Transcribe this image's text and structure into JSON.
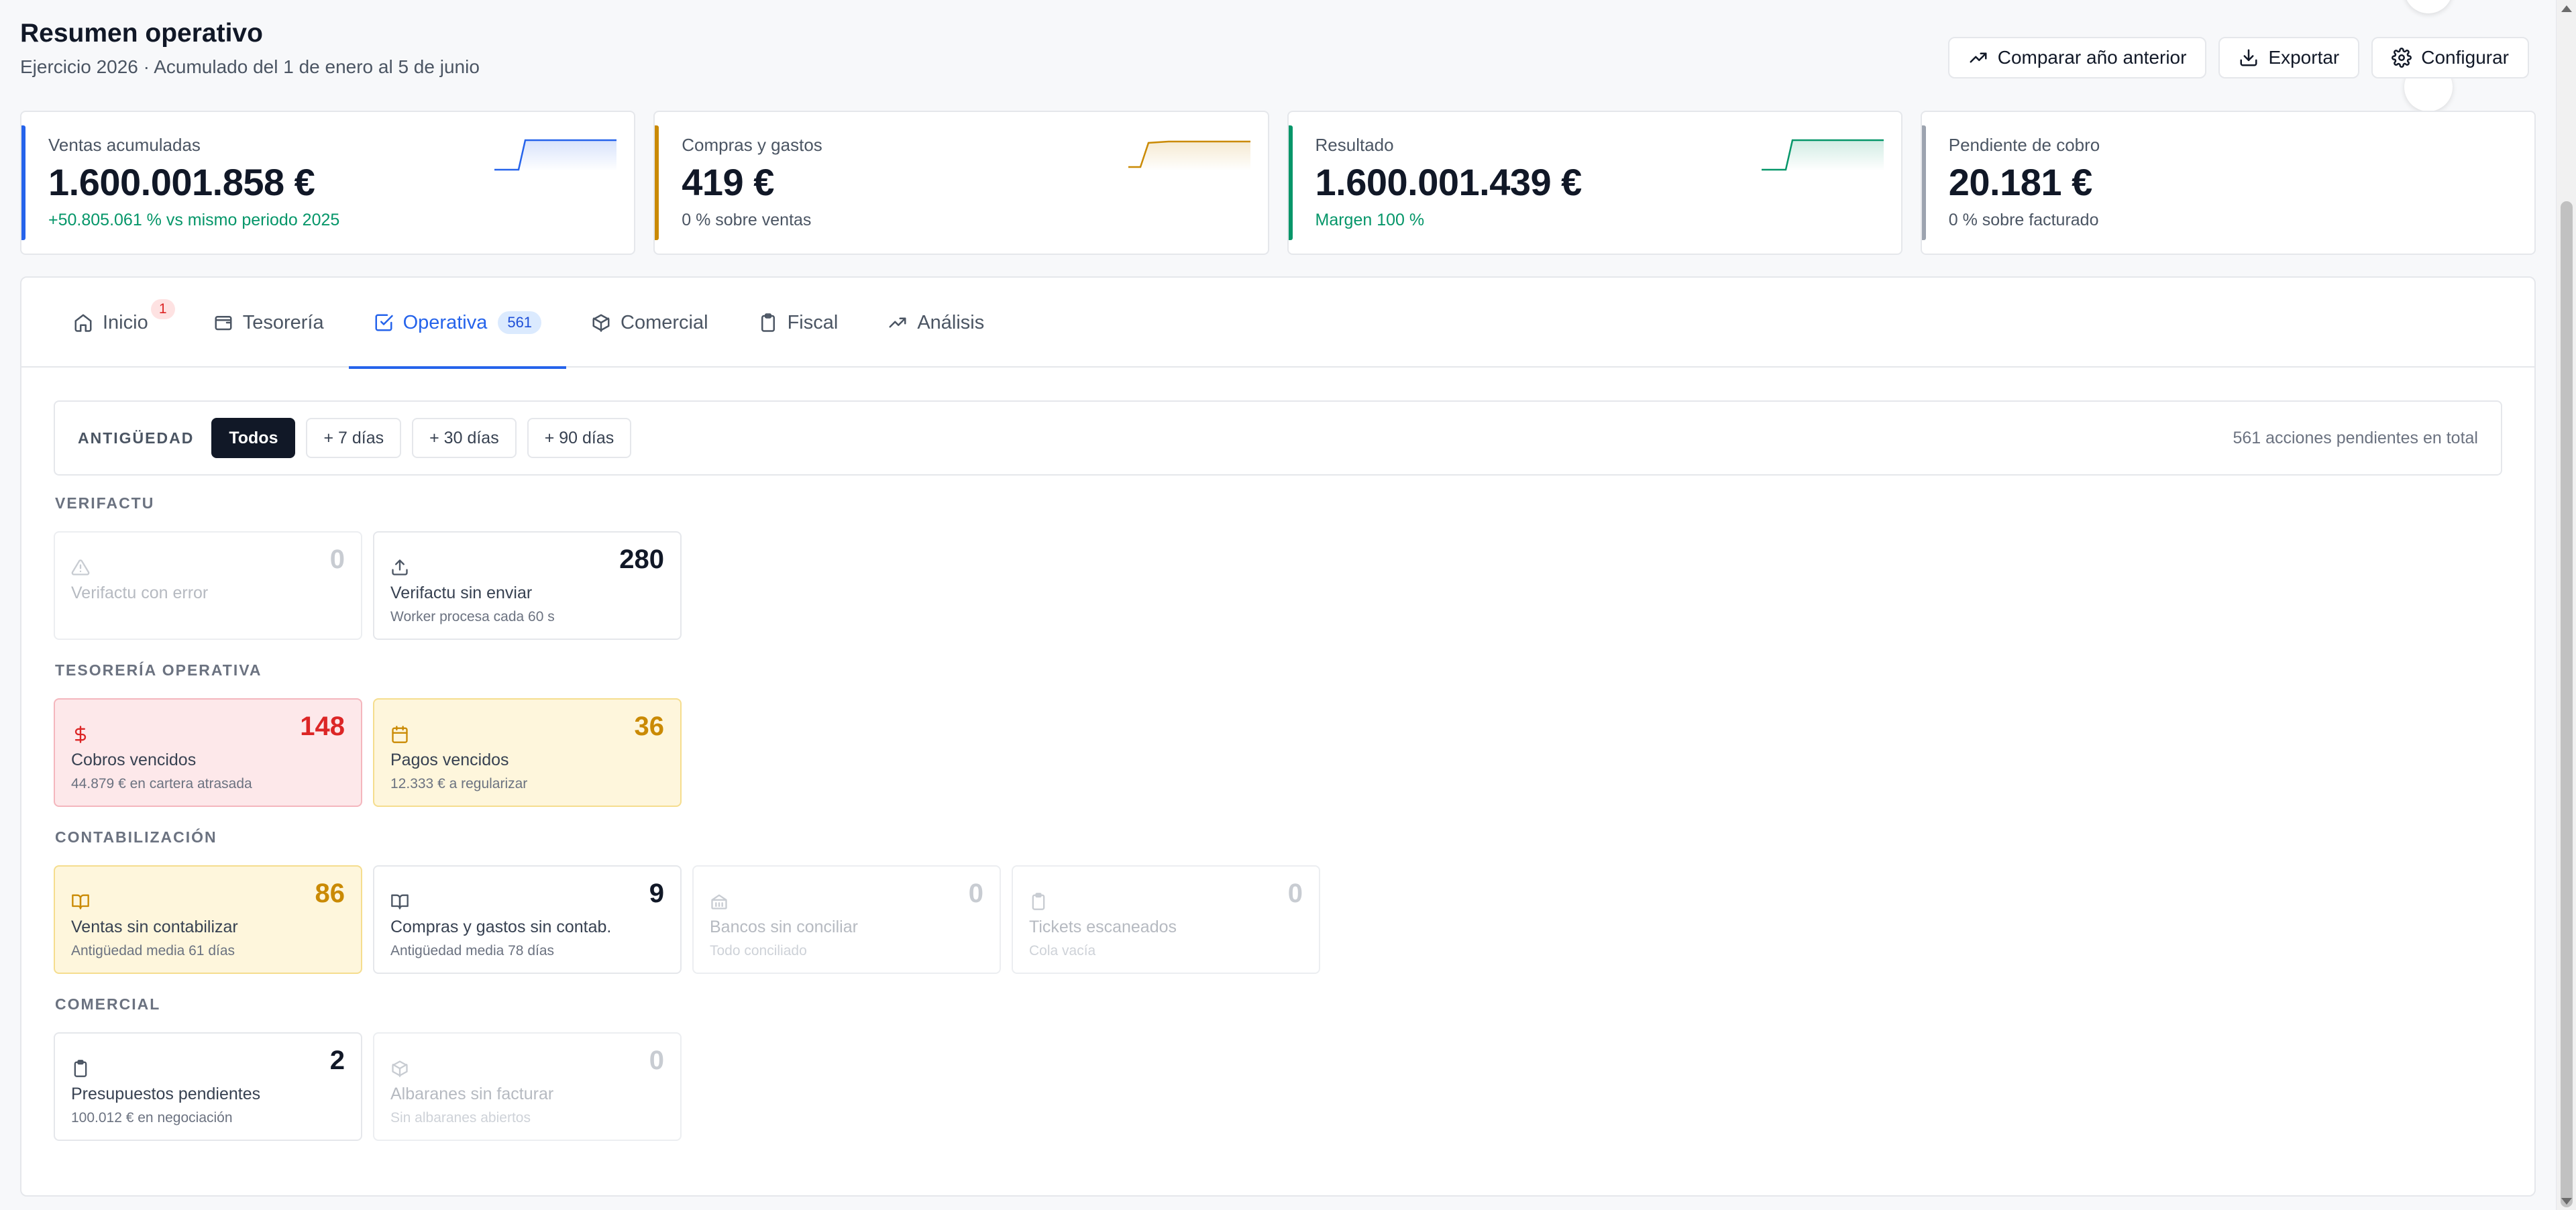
{
  "header": {
    "title": "Resumen operativo",
    "subtitle": "Ejercicio 2026 · Acumulado del 1 de enero al 5 de junio",
    "actions": {
      "compare": "Comparar año anterior",
      "export": "Exportar",
      "configure": "Configurar"
    }
  },
  "kpis": [
    {
      "label": "Ventas acumuladas",
      "value": "1.600.001.858 €",
      "note": "+50.805.061 % vs mismo periodo 2025",
      "color": "#2563eb"
    },
    {
      "label": "Compras y gastos",
      "value": "419 €",
      "note": "0 % sobre ventas",
      "color": "#ca8a04"
    },
    {
      "label": "Resultado",
      "value": "1.600.001.439 €",
      "note": "Margen 100 %",
      "color": "#059669"
    },
    {
      "label": "Pendiente de cobro",
      "value": "20.181 €",
      "note": "0 % sobre facturado",
      "color": "#9ca3af"
    }
  ],
  "tabs": [
    {
      "label": "Inicio",
      "badge": "1",
      "icon": "home-icon"
    },
    {
      "label": "Tesorería",
      "icon": "wallet-icon"
    },
    {
      "label": "Operativa",
      "count": "561",
      "icon": "check-square-icon",
      "active": true
    },
    {
      "label": "Comercial",
      "icon": "box-icon"
    },
    {
      "label": "Fiscal",
      "icon": "clipboard-icon"
    },
    {
      "label": "Análisis",
      "icon": "trend-icon"
    }
  ],
  "filter": {
    "label": "ANTIGÜEDAD",
    "chips": [
      "Todos",
      "+ 7 días",
      "+ 30 días",
      "+ 90 días"
    ],
    "selected": "Todos",
    "total": "561 acciones pendientes en total"
  },
  "sections": {
    "verifactu": {
      "title": "VERIFACTU",
      "cards": [
        {
          "num": "0",
          "title": "Verifactu con error",
          "sub": "",
          "icon": "warning-icon",
          "state": "dim"
        },
        {
          "num": "280",
          "title": "Verifactu sin enviar",
          "sub": "Worker procesa cada 60 s",
          "icon": "upload-icon",
          "state": "normal"
        }
      ]
    },
    "tesoreria": {
      "title": "TESORERÍA OPERATIVA",
      "cards": [
        {
          "num": "148",
          "title": "Cobros vencidos",
          "sub": "44.879 € en cartera atrasada",
          "icon": "dollar-icon",
          "state": "red"
        },
        {
          "num": "36",
          "title": "Pagos vencidos",
          "sub": "12.333 € a regularizar",
          "icon": "calendar-icon",
          "state": "amber"
        }
      ]
    },
    "contabilizacion": {
      "title": "CONTABILIZACIÓN",
      "cards": [
        {
          "num": "86",
          "title": "Ventas sin contabilizar",
          "sub": "Antigüedad media 61 días",
          "icon": "book-icon",
          "state": "amber"
        },
        {
          "num": "9",
          "title": "Compras y gastos sin contab.",
          "sub": "Antigüedad media 78 días",
          "icon": "book-icon",
          "state": "normal"
        },
        {
          "num": "0",
          "title": "Bancos sin conciliar",
          "sub": "Todo conciliado",
          "icon": "bank-icon",
          "state": "dim"
        },
        {
          "num": "0",
          "title": "Tickets escaneados",
          "sub": "Cola vacía",
          "icon": "ticket-icon",
          "state": "dim"
        }
      ]
    },
    "comercial": {
      "title": "COMERCIAL",
      "cards": [
        {
          "num": "2",
          "title": "Presupuestos pendientes",
          "sub": "100.012 € en negociación",
          "icon": "clipboard-icon",
          "state": "normal"
        },
        {
          "num": "0",
          "title": "Albaranes sin facturar",
          "sub": "Sin albaranes abiertos",
          "icon": "package-icon",
          "state": "dim"
        }
      ]
    }
  }
}
